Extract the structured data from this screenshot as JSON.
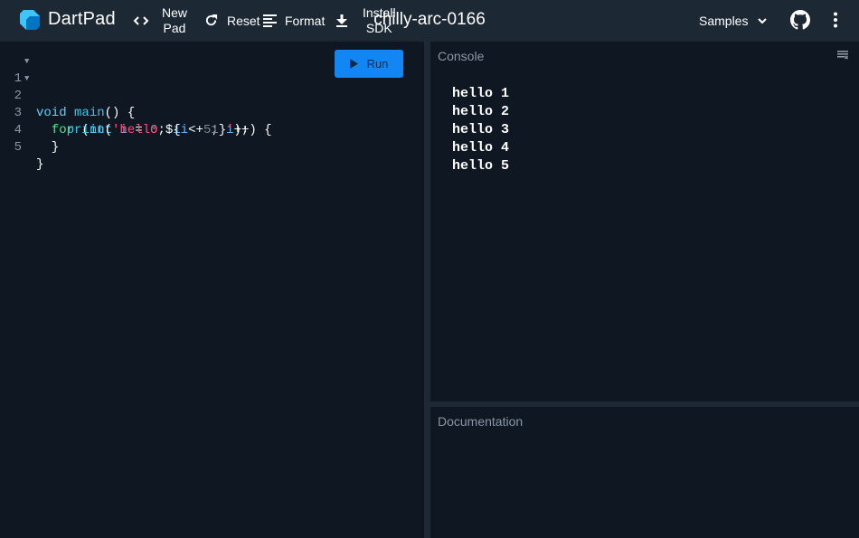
{
  "header": {
    "brand": "DartPad",
    "new_pad": [
      "New",
      "Pad"
    ],
    "reset": "Reset",
    "format": "Format",
    "install_sdk": [
      "Install",
      "SDK"
    ],
    "pad_name": "chilly-arc-0166",
    "samples": "Samples",
    "icons": {
      "logo": "dart-logo-icon",
      "new_pad": "code-brackets-icon",
      "reset": "refresh-icon",
      "format": "format-lines-icon",
      "install": "download-icon",
      "samples": "chevron-down-icon",
      "github": "github-icon",
      "menu": "more-vert-icon"
    }
  },
  "editor": {
    "run_label": "Run",
    "line_numbers": [
      "1",
      "2",
      "3",
      "4",
      "5"
    ],
    "lines": [
      "void main() {",
      "  for (int i = 0; i < 5; i++) {",
      "    print('hello ${i + 1}');",
      "  }",
      "}"
    ]
  },
  "console": {
    "title": "Console",
    "output": [
      "hello 1",
      "hello 2",
      "hello 3",
      "hello 4",
      "hello 5"
    ]
  },
  "documentation": {
    "title": "Documentation"
  },
  "colors": {
    "accent": "#1287f3",
    "background": "#0f1722",
    "chrome": "#1c2834"
  }
}
